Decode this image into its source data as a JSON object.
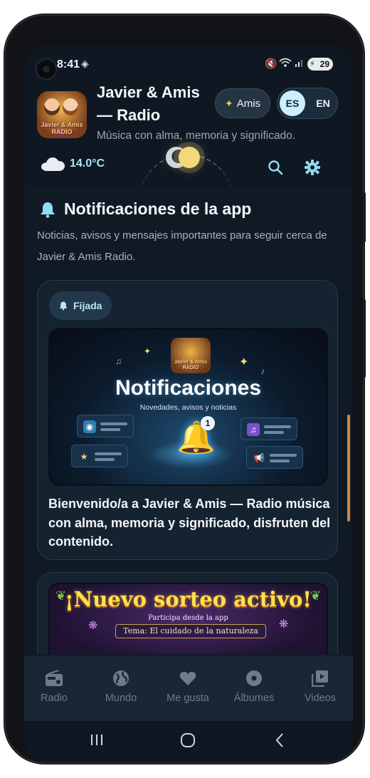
{
  "status_bar": {
    "time": "8:41",
    "battery": "29"
  },
  "header": {
    "title": "Javier & Amis — Radio",
    "subtitle": "Música con alma, memoria y significado.",
    "logo_text": "Javier & Amis RADIO",
    "amis_button": "Amis",
    "lang_es": "ES",
    "lang_en": "EN",
    "temperature": "14.0°C",
    "icons": [
      "cloud-icon",
      "moon-icon",
      "sun-icon",
      "search-icon",
      "gear-icon"
    ]
  },
  "section": {
    "title": "Notificaciones de la app",
    "description": "Noticias, avisos y mensajes importantes para seguir cerca de Javier & Amis Radio."
  },
  "notification_card": {
    "pinned_label": "Fijada",
    "banner_title": "Notificaciones",
    "banner_subtitle": "Novedades, avisos y noticias",
    "banner_logo_text": "Javier & Amis RADIO",
    "badge_count": "1",
    "message": "Bienvenido/a a Javier & Amis — Radio música con alma, memoria y significado, disfruten del contenido."
  },
  "raffle_card": {
    "title": "¡Nuevo sorteo activo!",
    "subtitle": "Participa desde la app",
    "theme": "Tema: El cuidado de la naturaleza"
  },
  "bottom_nav": {
    "items": [
      {
        "label": "Radio",
        "icon": "radio-icon"
      },
      {
        "label": "Mundo",
        "icon": "globe-icon"
      },
      {
        "label": "Me gusta",
        "icon": "heart-icon"
      },
      {
        "label": "Álbumes",
        "icon": "disc-icon"
      },
      {
        "label": "Videos",
        "icon": "video-icon"
      }
    ]
  },
  "colors": {
    "background": "#0f1822",
    "card": "#152330",
    "accent": "#8fdcf3",
    "scroll_indicator": "#d7863a"
  }
}
